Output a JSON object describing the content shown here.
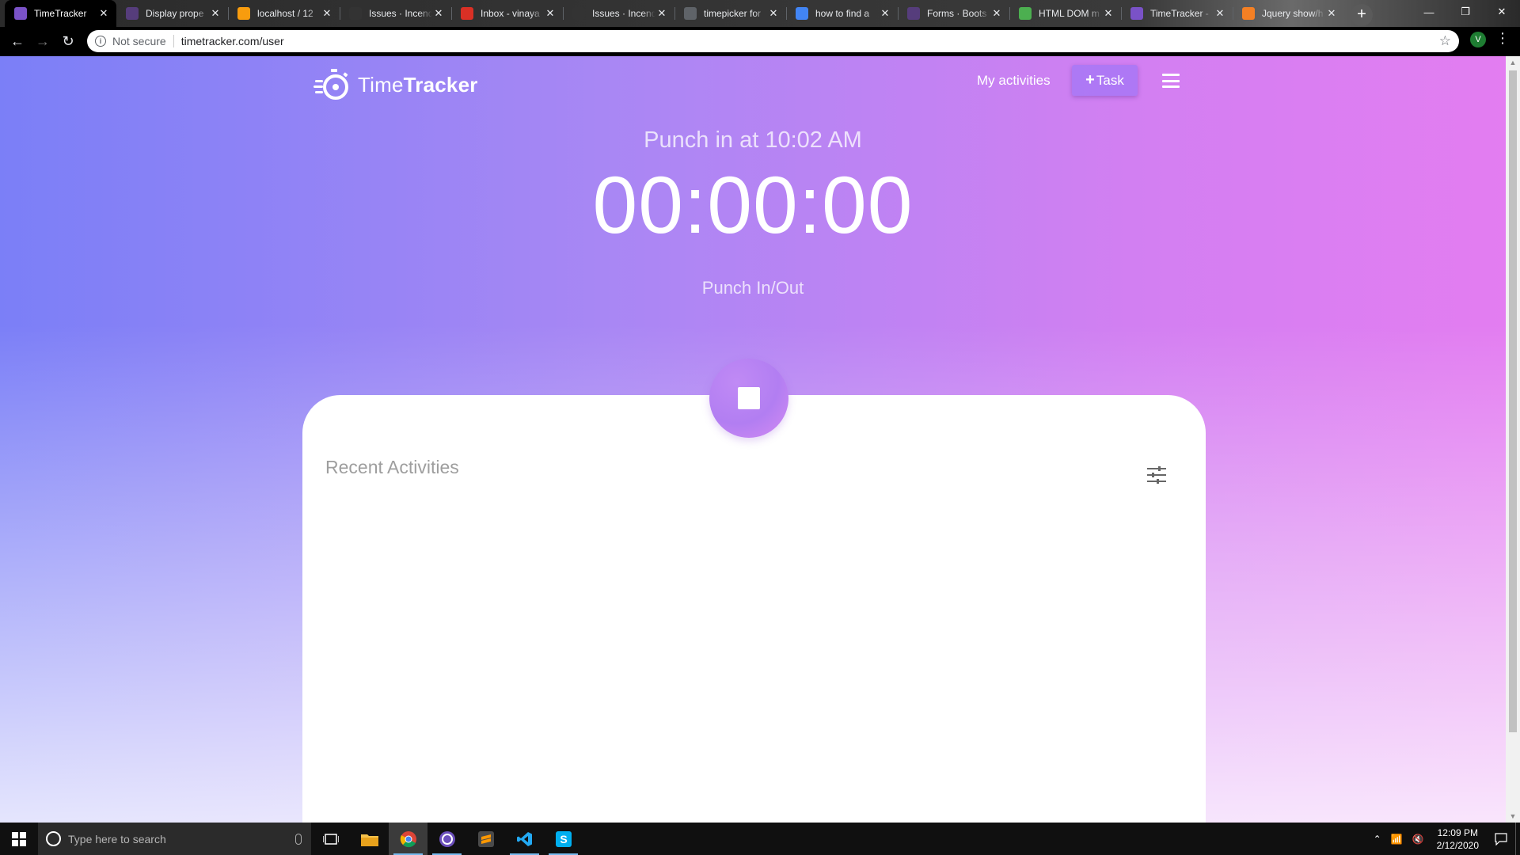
{
  "browser": {
    "tabs": [
      {
        "title": "TimeTracker",
        "favicon": "timetracker-icon",
        "color": "#7a52c7",
        "active": true
      },
      {
        "title": "Display prope",
        "favicon": "bootstrap-icon",
        "color": "#563d7c"
      },
      {
        "title": "localhost / 12",
        "favicon": "phpmyadmin-icon",
        "color": "#f89c0e"
      },
      {
        "title": "Issues · Incend",
        "favicon": "github-icon",
        "color": "#333333"
      },
      {
        "title": "Inbox - vinaya",
        "favicon": "gmail-icon",
        "color": "#d93025"
      },
      {
        "title": "Issues · Incend",
        "favicon": "github-icon",
        "color": "#333333"
      },
      {
        "title": "timepicker for",
        "favicon": "globe-icon",
        "color": "#5f6368"
      },
      {
        "title": "how to find a",
        "favicon": "google-icon",
        "color": "#4285f4"
      },
      {
        "title": "Forms · Boots",
        "favicon": "bootstrap-icon",
        "color": "#563d7c"
      },
      {
        "title": "HTML DOM m",
        "favicon": "w3schools-icon",
        "color": "#4caf50"
      },
      {
        "title": "TimeTracker -",
        "favicon": "timetracker-icon",
        "color": "#7a52c7"
      },
      {
        "title": "Jquery show/h",
        "favicon": "stackoverflow-icon",
        "color": "#f48024"
      }
    ],
    "security_label": "Not secure",
    "url": "timetracker.com/user",
    "profile_initial": "V"
  },
  "app": {
    "brand_light": "Time",
    "brand_bold": "Tracker",
    "nav_activities": "My activities",
    "task_button": "Task",
    "punch_in_at": "Punch in at 10:02 AM",
    "timer": "00:00:00",
    "punch_inout": "Punch In/Out",
    "recent_activities": "Recent Activities",
    "colors": {
      "gradient_left": "#7b7ff7",
      "gradient_right": "#e37df1",
      "accent": "#b27ef2"
    }
  },
  "taskbar": {
    "search_placeholder": "Type here to search",
    "apps": [
      "file-explorer-icon",
      "chrome-icon",
      "timetracker-app-icon",
      "sublime-text-icon",
      "vscode-icon",
      "skype-icon"
    ],
    "time": "12:09 PM",
    "date": "2/12/2020"
  }
}
